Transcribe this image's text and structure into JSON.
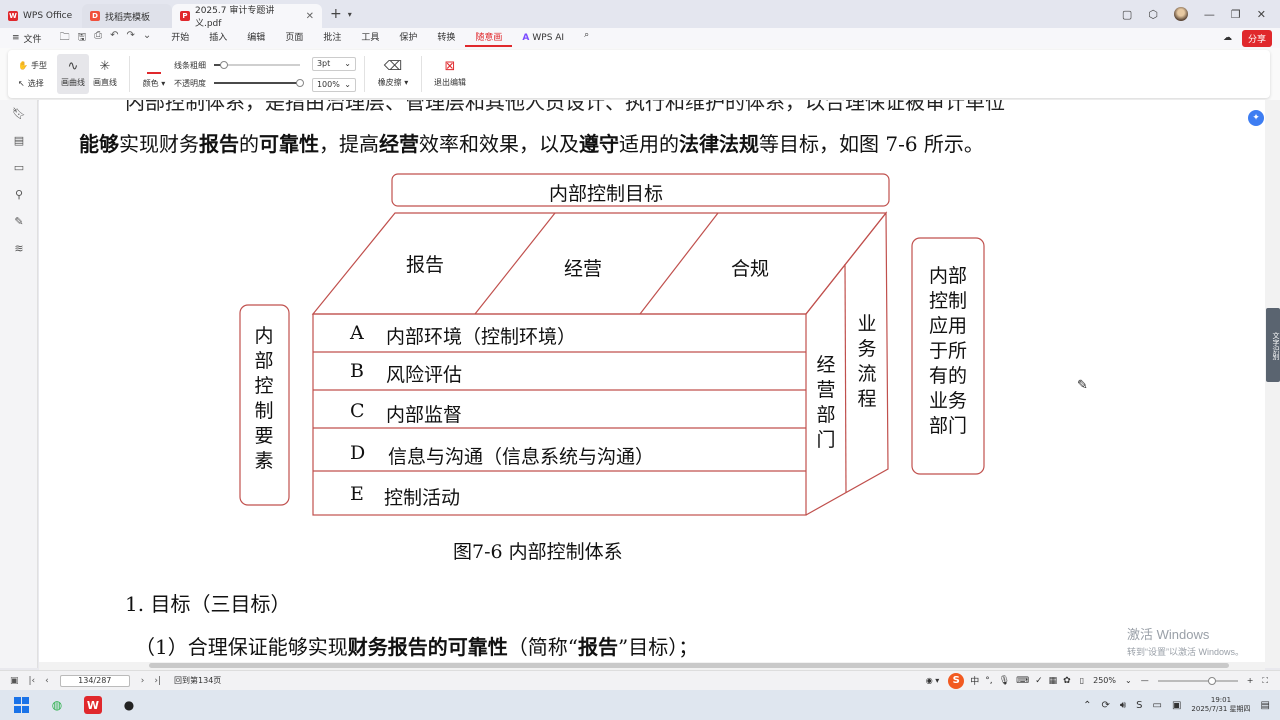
{
  "tabs": [
    {
      "label": "WPS Office",
      "logo": "W"
    },
    {
      "label": "找稻壳模板",
      "logo": "D"
    },
    {
      "label": "2025.7 审计专题讲义.pdf",
      "logo": "P"
    }
  ],
  "menu": {
    "file": "文件",
    "items": [
      "开始",
      "插入",
      "编辑",
      "页面",
      "批注",
      "工具",
      "保护",
      "转换",
      "随意画"
    ],
    "ai_mark": "A",
    "ai": "WPS AI",
    "share": "分享"
  },
  "ribbon": {
    "hand": "手型",
    "select": "选择",
    "curve": "画曲线",
    "straight": "画直线",
    "color": "颜色",
    "line_width_label": "线条粗细",
    "line_width_value": "3pt",
    "opacity_label": "不透明度",
    "opacity_value": "100%",
    "line_width_fraction": 0.12,
    "opacity_fraction": 1.0,
    "eraser": "橡皮擦",
    "exit": "退出编辑"
  },
  "document": {
    "line1_partial": "内部控制体系，是指由治理层、管理层和其他人员设计、执行和维护的体系，以合理保证被审计单位",
    "line2": [
      {
        "t": "能够",
        "b": true
      },
      {
        "t": "实现财务",
        "b": false
      },
      {
        "t": "报告",
        "b": true
      },
      {
        "t": "的",
        "b": false
      },
      {
        "t": "可靠性",
        "b": true
      },
      {
        "t": "，提高",
        "b": false
      },
      {
        "t": "经营",
        "b": true
      },
      {
        "t": "效率和效果，以及",
        "b": false
      },
      {
        "t": "遵守",
        "b": true
      },
      {
        "t": "适用的",
        "b": false
      },
      {
        "t": "法律法规",
        "b": true
      },
      {
        "t": "等目标，如图 7-6 所示。",
        "b": false
      }
    ],
    "diagram": {
      "top_title": "内部控制目标",
      "objectives": [
        "报告",
        "经营",
        "合规"
      ],
      "left_label": "内部控制要素",
      "elements": [
        {
          "letter": "A",
          "text": "内部环境（控制环境）"
        },
        {
          "letter": "B",
          "text": "风险评估"
        },
        {
          "letter": "C",
          "text": "内部监督"
        },
        {
          "letter": "D",
          "text": "信息与沟通（信息系统与沟通）"
        },
        {
          "letter": "E",
          "text": "控制活动"
        }
      ],
      "side1": "经营部门",
      "side2": "业务流程",
      "right_label": "内部控制应用于所有的业务部门"
    },
    "caption": "图7-6    内部控制体系",
    "heading": "1. 目标（三目标）",
    "line3": [
      {
        "t": "（1）合理保证能够实现",
        "b": false
      },
      {
        "t": "财务报告的可靠性",
        "b": true
      },
      {
        "t": "（简称“",
        "b": false
      },
      {
        "t": "报告",
        "b": true
      },
      {
        "t": "”目标）；",
        "b": false
      }
    ]
  },
  "watermark": {
    "line1": "激活 Windows",
    "line2": "转到“设置”以激活 Windows。"
  },
  "side_widget": "文字识别",
  "status": {
    "page": "134/287",
    "goto": "回到第134页",
    "zoom": "250%",
    "zoom_fraction": 0.68,
    "ime": "中"
  },
  "taskbar": {
    "time": "19:01",
    "date": "2025/7/31 星期四"
  },
  "colors": {
    "accent": "#e0282c",
    "blue": "#3d7df2"
  }
}
